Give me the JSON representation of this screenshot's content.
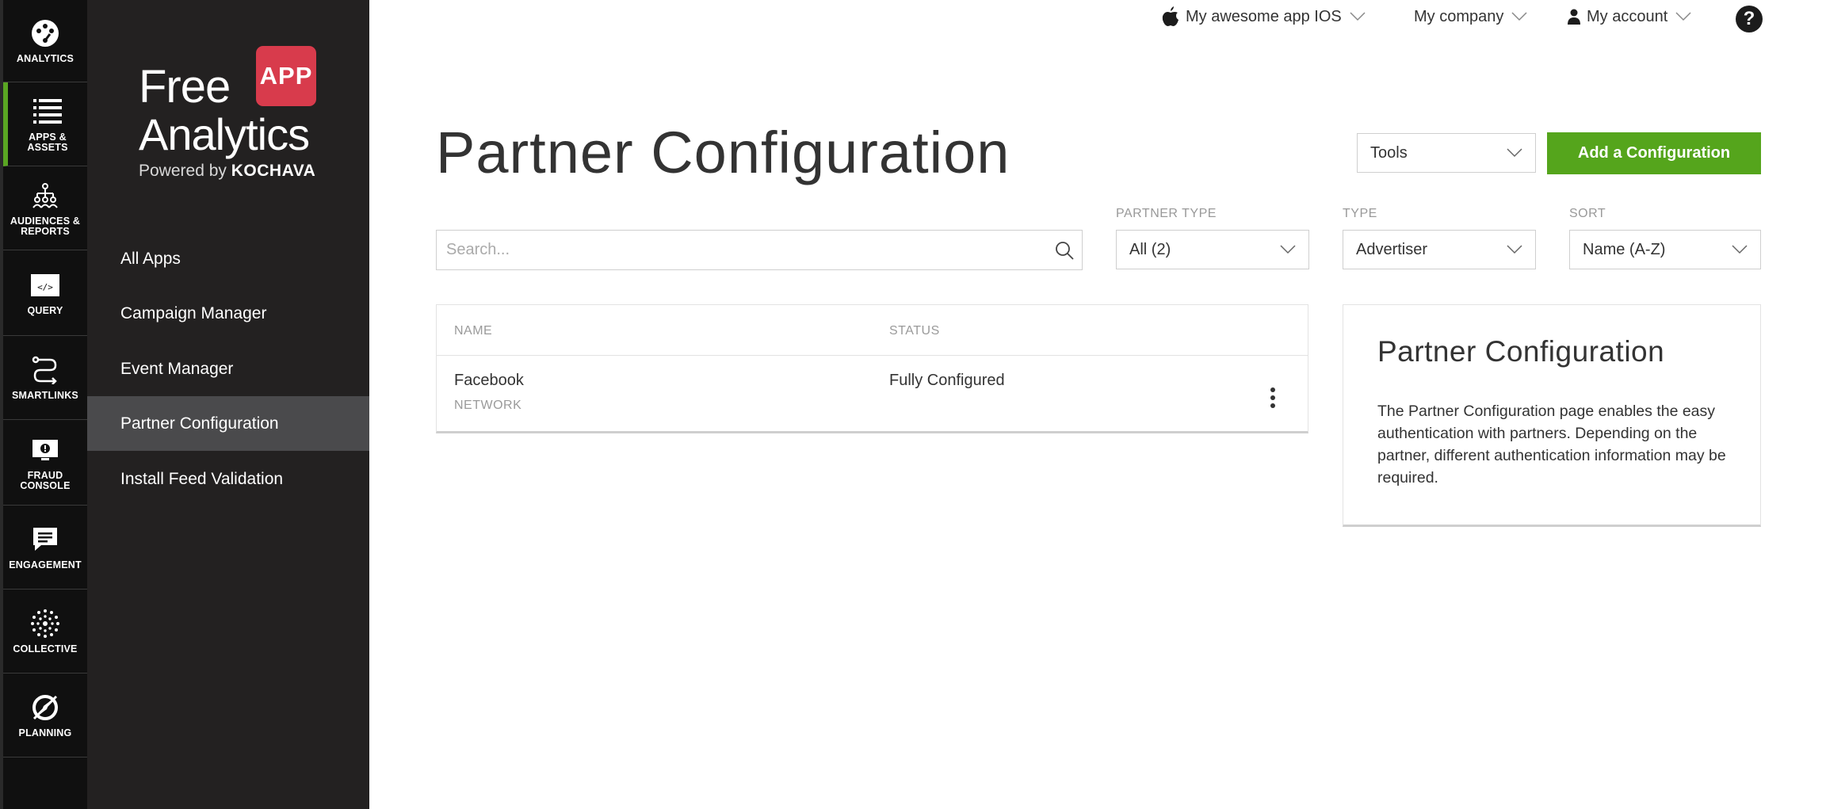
{
  "rail": [
    {
      "name": "rail-analytics",
      "icon": "palette-gauge-icon",
      "label": "ANALYTICS",
      "active": false
    },
    {
      "name": "rail-apps-assets",
      "icon": "list-icon",
      "label": "APPS &\nASSETS",
      "active": true
    },
    {
      "name": "rail-audiences-reports",
      "icon": "people-tree-icon",
      "label": "AUDIENCES &\nREPORTS",
      "active": false
    },
    {
      "name": "rail-query",
      "icon": "code-window-icon",
      "label": "QUERY",
      "active": false
    },
    {
      "name": "rail-smartlinks",
      "icon": "link-path-icon",
      "label": "SMARTLINKS",
      "active": false
    },
    {
      "name": "rail-fraud-console",
      "icon": "alert-monitor-icon",
      "label": "FRAUD\nCONSOLE",
      "active": false
    },
    {
      "name": "rail-engagement",
      "icon": "chat-bubble-icon",
      "label": "ENGAGEMENT",
      "active": false
    },
    {
      "name": "rail-collective",
      "icon": "dots-circle-icon",
      "label": "COLLECTIVE",
      "active": false
    },
    {
      "name": "rail-planning",
      "icon": "compass-icon",
      "label": "PLANNING",
      "active": false
    }
  ],
  "brand": {
    "word1": "Free",
    "word2": "Analytics",
    "badge": "APP",
    "powered": "Powered by",
    "powered_brand": "KOCHAVA"
  },
  "sidenav": {
    "items": [
      {
        "label": "All Apps",
        "active": false
      },
      {
        "label": "Campaign Manager",
        "active": false
      },
      {
        "label": "Event Manager",
        "active": false
      },
      {
        "label": "Partner Configuration",
        "active": true
      },
      {
        "label": "Install Feed Validation",
        "active": false
      }
    ]
  },
  "topbar": {
    "app": "My awesome app IOS",
    "company": "My company",
    "account": "My account",
    "help": "?"
  },
  "page": {
    "title": "Partner Configuration",
    "tools": "Tools",
    "add_button": "Add a Configuration"
  },
  "filters": {
    "search_placeholder": "Search...",
    "partner_type_label": "PARTNER TYPE",
    "partner_type_value": "All (2)",
    "type_label": "TYPE",
    "type_value": "Advertiser",
    "sort_label": "SORT",
    "sort_value": "Name (A-Z)"
  },
  "table": {
    "columns": [
      "NAME",
      "STATUS"
    ],
    "rows": [
      {
        "name": "Facebook",
        "kind": "NETWORK",
        "status": "Fully Configured"
      }
    ]
  },
  "info": {
    "title": "Partner Configuration",
    "body": "The Partner Configuration page enables the easy authentication with partners. Depending on the partner, different authentication information may be required."
  },
  "colors": {
    "accent_green": "#55a51c",
    "brand_red": "#d83b4c",
    "rail_bg": "#101010",
    "nav_bg": "#232121",
    "nav_active": "#4a4a4c"
  }
}
